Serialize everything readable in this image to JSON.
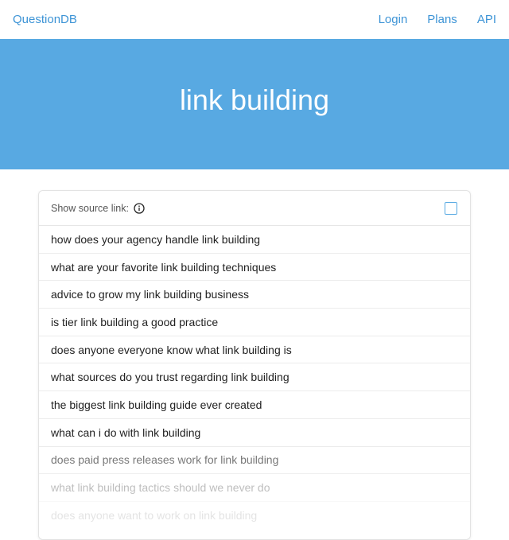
{
  "nav": {
    "brand": "QuestionDB",
    "links": [
      "Login",
      "Plans",
      "API"
    ]
  },
  "hero": {
    "title": "link building"
  },
  "card": {
    "source_label": "Show source link:",
    "info_icon": "info-circle-icon",
    "checkbox_checked": false,
    "questions": [
      "how does your agency handle link building",
      "what are your favorite link building techniques",
      "advice to grow my link building business",
      "is tier link building a good practice",
      "does anyone everyone know what link building is",
      "what sources do you trust regarding link building",
      "the biggest link building guide ever created",
      "what can i do with link building",
      "does paid press releases work for link building",
      "what link building tactics should we never do",
      "does anyone want to work on link building"
    ]
  },
  "colors": {
    "accent": "#58a9e2",
    "link": "#3d94d6"
  }
}
